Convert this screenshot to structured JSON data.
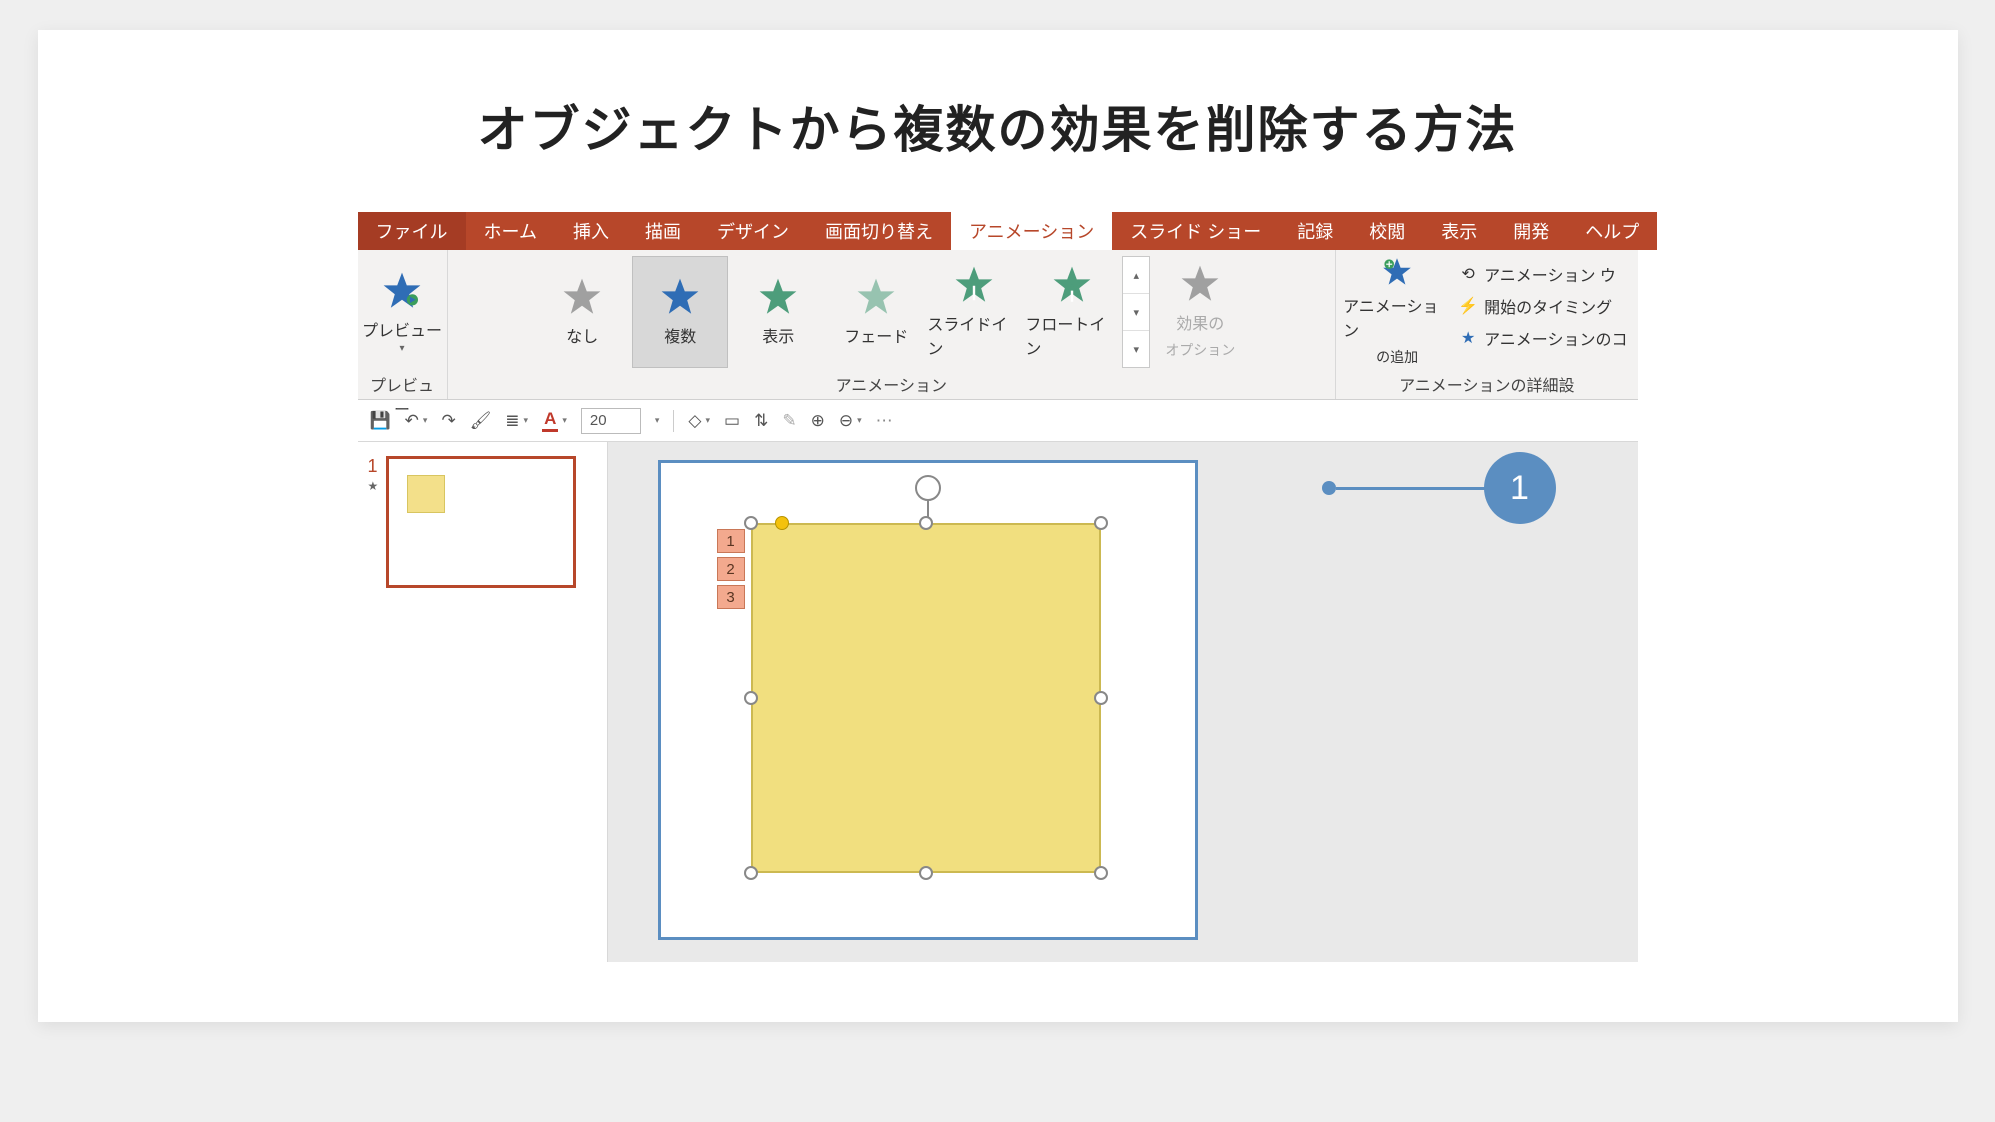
{
  "title": "オブジェクトから複数の効果を削除する方法",
  "tabs": {
    "file": "ファイル",
    "home": "ホーム",
    "insert": "挿入",
    "draw": "描画",
    "design": "デザイン",
    "transitions": "画面切り替え",
    "animations": "アニメーション",
    "slideshow": "スライド ショー",
    "record": "記録",
    "review": "校閲",
    "view": "表示",
    "developer": "開発",
    "help": "ヘルプ"
  },
  "ribbon": {
    "preview": {
      "label": "プレビュー",
      "group": "プレビュー"
    },
    "gallery": {
      "none": "なし",
      "multiple": "複数",
      "appear": "表示",
      "fade": "フェード",
      "slidein": "スライドイン",
      "floatin": "フロートイン",
      "group": "アニメーション"
    },
    "effectOptions": {
      "label": "効果の",
      "label2": "オプション"
    },
    "addAnimation": {
      "label": "アニメーション",
      "label2": "の追加"
    },
    "advanced": {
      "pane": "アニメーション ウ",
      "trigger": "開始のタイミング",
      "painter": "アニメーションのコ",
      "group": "アニメーションの詳細設"
    }
  },
  "qat": {
    "fontsize": "20"
  },
  "thumbnail": {
    "number": "1"
  },
  "animTags": [
    "1",
    "2",
    "3"
  ],
  "callout": {
    "num": "1"
  }
}
